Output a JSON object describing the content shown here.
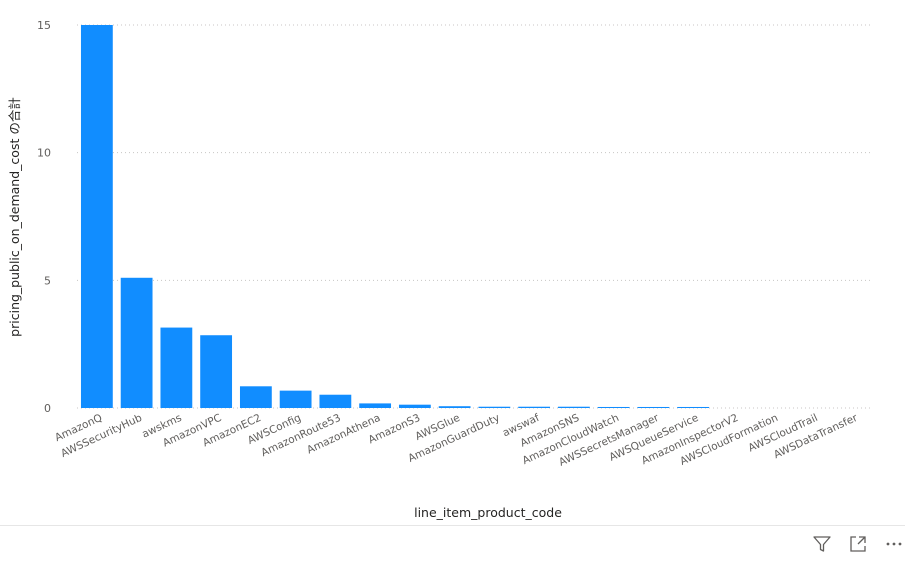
{
  "chart_data": {
    "type": "bar",
    "categories": [
      "AmazonQ",
      "AWSSecurityHub",
      "awskms",
      "AmazonVPC",
      "AmazonEC2",
      "AWSConfig",
      "AmazonRoute53",
      "AmazonAthena",
      "AmazonS3",
      "AWSGlue",
      "AmazonGuardDuty",
      "awswaf",
      "AmazonSNS",
      "AmazonCloudWatch",
      "AWSSecretsManager",
      "AWSQueueService",
      "AmazonInspectorV2",
      "AWSCloudFormation",
      "AWSCloudTrail",
      "AWSDataTransfer"
    ],
    "values": [
      15.0,
      5.1,
      3.15,
      2.85,
      0.85,
      0.68,
      0.52,
      0.18,
      0.13,
      0.07,
      0.05,
      0.05,
      0.05,
      0.04,
      0.04,
      0.04,
      0,
      0,
      0,
      0
    ],
    "xlabel": "line_item_product_code",
    "ylabel": "pricing_public_on_demand_cost の合計",
    "ylim": [
      0,
      15
    ],
    "yticks": [
      0,
      5,
      10,
      15
    ],
    "grid": true,
    "bar_color": "#118DFF",
    "grid_color": "#c8c6c4"
  },
  "toolbar": {
    "filter_icon": "filter-icon",
    "focus_icon": "focus-mode-icon",
    "more_icon": "more-options-icon"
  }
}
